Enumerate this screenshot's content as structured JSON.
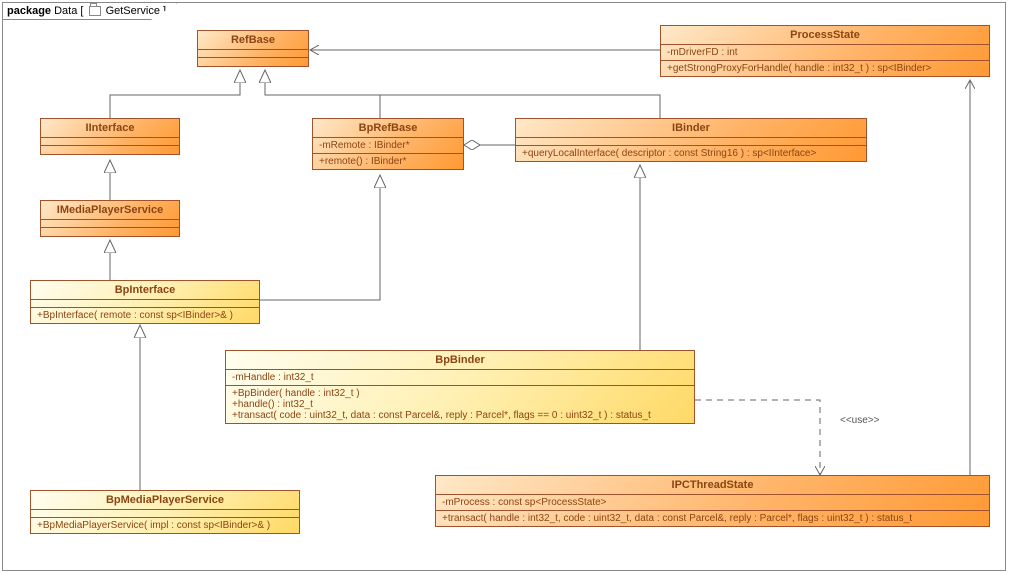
{
  "package": {
    "keyword": "package",
    "name": "Data",
    "diagram": "GetService"
  },
  "classes": {
    "RefBase": {
      "name": "RefBase",
      "attrs": [],
      "methods": []
    },
    "ProcessState": {
      "name": "ProcessState",
      "attrs": [
        "-mDriverFD : int"
      ],
      "methods": [
        "+getStrongProxyForHandle( handle : int32_t ) : sp<IBinder>"
      ]
    },
    "IInterface": {
      "name": "IInterface",
      "attrs": [],
      "methods": []
    },
    "BpRefBase": {
      "name": "BpRefBase",
      "attrs": [
        "-mRemote : IBinder*"
      ],
      "methods": [
        "+remote() : IBinder*"
      ]
    },
    "IBinder": {
      "name": "IBinder",
      "attrs": [],
      "methods": [
        "+queryLocalInterface( descriptor : const String16 ) : sp<IInterface>"
      ]
    },
    "IMediaPlayerService": {
      "name": "IMediaPlayerService",
      "attrs": [],
      "methods": []
    },
    "BpInterface": {
      "name": "BpInterface",
      "attrs": [],
      "methods": [
        "+BpInterface( remote : const sp<IBinder>& )"
      ]
    },
    "BpBinder": {
      "name": "BpBinder",
      "attrs": [
        "-mHandle : int32_t"
      ],
      "methods": [
        "+BpBinder( handle : int32_t )",
        "+handle() : int32_t",
        "+transact( code : uint32_t, data : const Parcel&, reply : Parcel*, flags == 0 : uint32_t ) : status_t"
      ]
    },
    "BpMediaPlayerService": {
      "name": "BpMediaPlayerService",
      "attrs": [],
      "methods": [
        "+BpMediaPlayerService( impl : const sp<IBinder>& )"
      ]
    },
    "IPCThreadState": {
      "name": "IPCThreadState",
      "attrs": [
        "-mProcess : const sp<ProcessState>"
      ],
      "methods": [
        "+transact( handle : int32_t, code : uint32_t, data : const Parcel&, reply : Parcel*, flags : uint32_t ) : status_t"
      ]
    }
  },
  "labels": {
    "use": "<<use>>"
  },
  "chart_data": {
    "type": "diagram",
    "diagram_type": "UML class diagram",
    "package": "Data",
    "diagram_name": "GetService",
    "classes": [
      {
        "name": "RefBase",
        "attributes": [],
        "operations": []
      },
      {
        "name": "ProcessState",
        "attributes": [
          "-mDriverFD : int"
        ],
        "operations": [
          "+getStrongProxyForHandle( handle : int32_t ) : sp<IBinder>"
        ]
      },
      {
        "name": "IInterface",
        "attributes": [],
        "operations": []
      },
      {
        "name": "BpRefBase",
        "attributes": [
          "-mRemote : IBinder*"
        ],
        "operations": [
          "+remote() : IBinder*"
        ]
      },
      {
        "name": "IBinder",
        "attributes": [],
        "operations": [
          "+queryLocalInterface( descriptor : const String16 ) : sp<IInterface>"
        ]
      },
      {
        "name": "IMediaPlayerService",
        "attributes": [],
        "operations": []
      },
      {
        "name": "BpInterface",
        "attributes": [],
        "operations": [
          "+BpInterface( remote : const sp<IBinder>& )"
        ]
      },
      {
        "name": "BpBinder",
        "attributes": [
          "-mHandle : int32_t"
        ],
        "operations": [
          "+BpBinder( handle : int32_t )",
          "+handle() : int32_t",
          "+transact( code : uint32_t, data : const Parcel&, reply : Parcel*, flags == 0 : uint32_t ) : status_t"
        ]
      },
      {
        "name": "BpMediaPlayerService",
        "attributes": [],
        "operations": [
          "+BpMediaPlayerService( impl : const sp<IBinder>& )"
        ]
      },
      {
        "name": "IPCThreadState",
        "attributes": [
          "-mProcess : const sp<ProcessState>"
        ],
        "operations": [
          "+transact( handle : int32_t, code : uint32_t, data : const Parcel&, reply : Parcel*, flags : uint32_t ) : status_t"
        ]
      }
    ],
    "relationships": [
      {
        "type": "generalization",
        "from": "IInterface",
        "to": "RefBase"
      },
      {
        "type": "generalization",
        "from": "BpRefBase",
        "to": "RefBase"
      },
      {
        "type": "generalization",
        "from": "IBinder",
        "to": "RefBase"
      },
      {
        "type": "generalization",
        "from": "IMediaPlayerService",
        "to": "IInterface"
      },
      {
        "type": "generalization",
        "from": "BpInterface",
        "to": "IMediaPlayerService"
      },
      {
        "type": "generalization",
        "from": "BpInterface",
        "to": "BpRefBase"
      },
      {
        "type": "generalization",
        "from": "BpBinder",
        "to": "IBinder"
      },
      {
        "type": "generalization",
        "from": "BpMediaPlayerService",
        "to": "BpInterface"
      },
      {
        "type": "association",
        "from": "ProcessState",
        "to": "RefBase"
      },
      {
        "type": "aggregation",
        "from": "BpRefBase",
        "to": "IBinder"
      },
      {
        "type": "association",
        "from": "IPCThreadState",
        "to": "ProcessState"
      },
      {
        "type": "dependency",
        "from": "BpBinder",
        "to": "IPCThreadState",
        "label": "<<use>>"
      }
    ]
  }
}
